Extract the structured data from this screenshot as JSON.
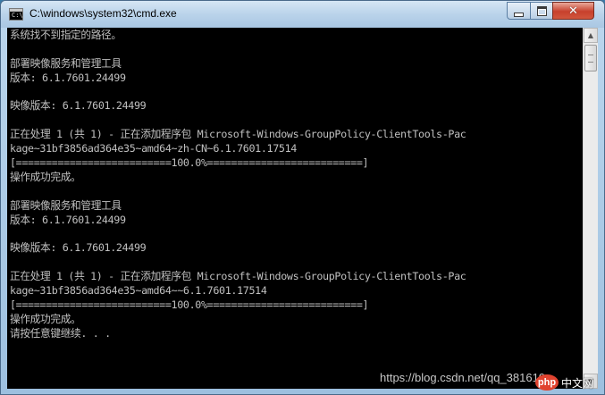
{
  "window": {
    "title": "C:\\windows\\system32\\cmd.exe",
    "app_icon_text": "C:\\",
    "close_glyph": "✕",
    "min_label": "",
    "max_label": ""
  },
  "console": {
    "lines": [
      "系统找不到指定的路径。",
      "",
      "部署映像服务和管理工具",
      "版本: 6.1.7601.24499",
      "",
      "映像版本: 6.1.7601.24499",
      "",
      "正在处理 1 (共 1) - 正在添加程序包 Microsoft-Windows-GroupPolicy-ClientTools-Pac",
      "kage~31bf3856ad364e35~amd64~zh-CN~6.1.7601.17514",
      "[==========================100.0%==========================]",
      "操作成功完成。",
      "",
      "部署映像服务和管理工具",
      "版本: 6.1.7601.24499",
      "",
      "映像版本: 6.1.7601.24499",
      "",
      "正在处理 1 (共 1) - 正在添加程序包 Microsoft-Windows-GroupPolicy-ClientTools-Pac",
      "kage~31bf3856ad364e35~amd64~~6.1.7601.17514",
      "[==========================100.0%==========================]",
      "操作成功完成。",
      "请按任意键继续. . ."
    ]
  },
  "scrollbar": {
    "up_arrow": "▲",
    "down_arrow": "▼"
  },
  "watermark": {
    "text": "https://blog.csdn.net/qq_381610",
    "site_logo": "php",
    "site_name": "中文网"
  },
  "colors": {
    "console_bg": "#000000",
    "console_fg": "#c0c0c0",
    "close_button": "#c7402c"
  }
}
